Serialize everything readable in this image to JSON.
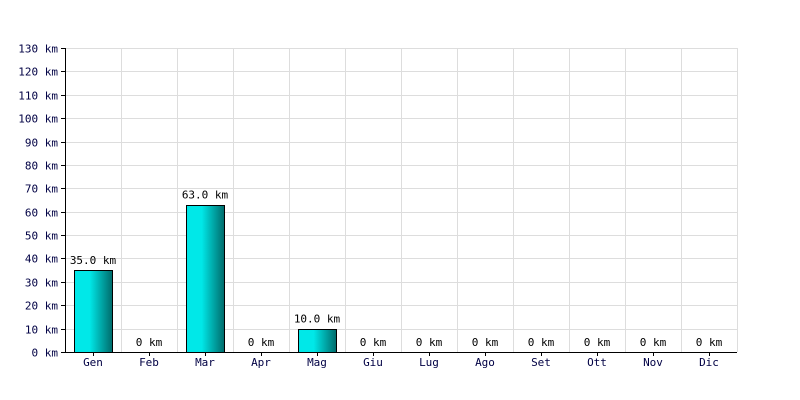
{
  "chart_data": {
    "type": "bar",
    "categories": [
      "Gen",
      "Feb",
      "Mar",
      "Apr",
      "Mag",
      "Giu",
      "Lug",
      "Ago",
      "Set",
      "Ott",
      "Nov",
      "Dic"
    ],
    "values": [
      35.0,
      0,
      63.0,
      0,
      10.0,
      0,
      0,
      0,
      0,
      0,
      0,
      0
    ],
    "data_labels": [
      "35.0 km",
      "0 km",
      "63.0 km",
      "0 km",
      "10.0 km",
      "0 km",
      "0 km",
      "0 km",
      "0 km",
      "0 km",
      "0 km",
      "0 km"
    ],
    "title": "",
    "xlabel": "",
    "ylabel": "",
    "ylim": [
      0,
      130
    ],
    "yticks": [
      0,
      10,
      20,
      30,
      40,
      50,
      60,
      70,
      80,
      90,
      100,
      110,
      120,
      130
    ],
    "ytick_labels": [
      "0 km",
      "10 km",
      "20 km",
      "30 km",
      "40 km",
      "50 km",
      "60 km",
      "70 km",
      "80 km",
      "90 km",
      "100 km",
      "110 km",
      "120 km",
      "130 km"
    ],
    "grid": true,
    "legend": "none",
    "colors": {
      "bar_light": "#00e8e8",
      "bar_dark": "#006a6a",
      "bar_stroke": "#000000",
      "grid": "#dddddd",
      "axis": "#000000",
      "text": "#000044"
    }
  }
}
